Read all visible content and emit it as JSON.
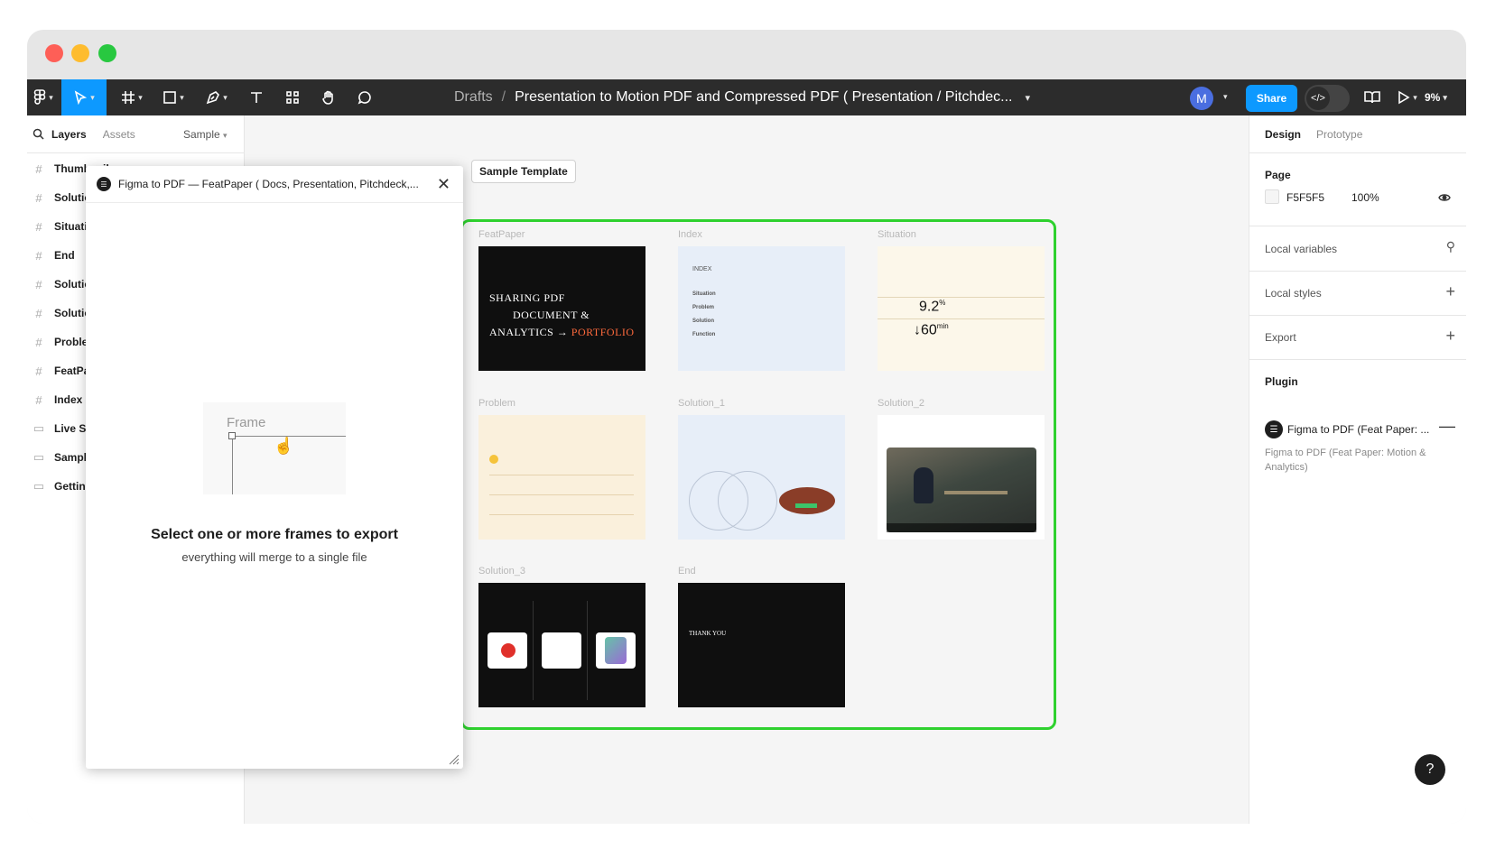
{
  "toolbar": {
    "breadcrumb_drafts": "Drafts",
    "breadcrumb_sep": "/",
    "file_title": "Presentation to Motion PDF and Compressed PDF ( Presentation / Pitchdec...",
    "avatar_initial": "M",
    "share_label": "Share",
    "zoom": "9%",
    "accent": "#0d99ff"
  },
  "left_panel": {
    "tabs": [
      "Layers",
      "Assets"
    ],
    "page_select": "Sample",
    "layers": [
      {
        "label": "Thumbnail",
        "icon": "frame-icon"
      },
      {
        "label": "Solutio",
        "icon": "frame-icon"
      },
      {
        "label": "Situati",
        "icon": "frame-icon"
      },
      {
        "label": "End",
        "icon": "frame-icon"
      },
      {
        "label": "Solutio",
        "icon": "frame-icon"
      },
      {
        "label": "Solutio",
        "icon": "frame-icon"
      },
      {
        "label": "Proble",
        "icon": "frame-icon"
      },
      {
        "label": "FeatPa",
        "icon": "frame-icon"
      },
      {
        "label": "Index",
        "icon": "frame-icon"
      },
      {
        "label": "Live Sa",
        "icon": "section-icon"
      },
      {
        "label": "Sample",
        "icon": "section-icon"
      },
      {
        "label": "Getting",
        "icon": "section-icon"
      }
    ]
  },
  "plugin": {
    "title": "Figma to PDF — FeatPaper ( Docs, Presentation, Pitchdeck,...",
    "frame_label": "Frame",
    "heading": "Select one or more frames to export",
    "subheading": "everything will merge to a single file"
  },
  "canvas": {
    "section_chip": "Sample Template",
    "section_border_color": "#2ed12e",
    "frames": [
      {
        "label": "FeatPaper"
      },
      {
        "label": "Index"
      },
      {
        "label": "Situation"
      },
      {
        "label": "Problem"
      },
      {
        "label": "Solution_1"
      },
      {
        "label": "Solution_2"
      },
      {
        "label": "Solution_3"
      },
      {
        "label": "End"
      }
    ],
    "featpaper_text": {
      "line1": "SHARING    PDF",
      "line2": "DOCUMENT  &",
      "line3": "ANALYTICS →",
      "line3b": "PORTFOLIO"
    },
    "index_text": {
      "heading": "INDEX",
      "items": [
        "Situation",
        "Problem",
        "Solution",
        "Function"
      ]
    },
    "situation_text": {
      "stat1": "9.2",
      "stat1_unit": "%",
      "stat2": "60",
      "stat2_unit": "min"
    },
    "end_text": {
      "line1": "THANK YOU"
    }
  },
  "right_panel": {
    "tabs": [
      "Design",
      "Prototype"
    ],
    "page_title": "Page",
    "page_color": "F5F5F5",
    "page_opacity": "100%",
    "local_variables": "Local variables",
    "local_styles": "Local styles",
    "export": "Export",
    "plugin_title": "Plugin",
    "plugin_name": "Figma to PDF (Feat Paper: ...",
    "plugin_desc": "Figma to PDF (Feat Paper: Motion & Analytics)"
  },
  "help_label": "?"
}
